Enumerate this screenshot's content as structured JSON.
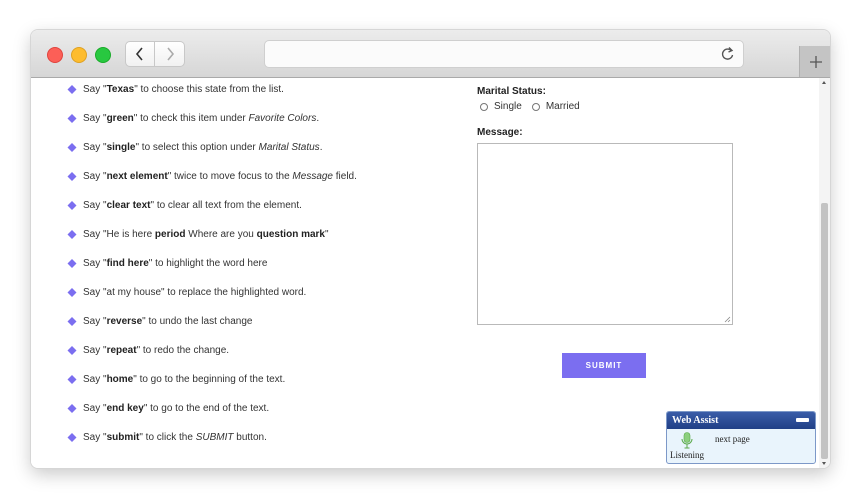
{
  "browser": {
    "url": "",
    "back_icon": "chevron-left-icon",
    "forward_icon": "chevron-right-icon",
    "reload_icon": "reload-icon",
    "new_tab_icon": "plus-icon"
  },
  "instructions": [
    {
      "parts": [
        [
          "n",
          "Say \""
        ],
        [
          "b",
          "Texas"
        ],
        [
          "n",
          "\" to choose this state from the list."
        ]
      ]
    },
    {
      "parts": [
        [
          "n",
          "Say \""
        ],
        [
          "b",
          "green"
        ],
        [
          "n",
          "\" to check this item under "
        ],
        [
          "i",
          "Favorite Colors"
        ],
        [
          "n",
          "."
        ]
      ]
    },
    {
      "parts": [
        [
          "n",
          "Say \""
        ],
        [
          "b",
          "single"
        ],
        [
          "n",
          "\" to select this option under "
        ],
        [
          "i",
          "Marital Status"
        ],
        [
          "n",
          "."
        ]
      ]
    },
    {
      "parts": [
        [
          "n",
          "Say \""
        ],
        [
          "b",
          "next element"
        ],
        [
          "n",
          "\" twice to move focus to the "
        ],
        [
          "i",
          "Message"
        ],
        [
          "n",
          " field."
        ]
      ]
    },
    {
      "parts": [
        [
          "n",
          "Say \""
        ],
        [
          "b",
          "clear text"
        ],
        [
          "n",
          "\" to clear all text from the element."
        ]
      ]
    },
    {
      "parts": [
        [
          "n",
          "Say \"He is here "
        ],
        [
          "b",
          "period"
        ],
        [
          "n",
          " Where are you "
        ],
        [
          "b",
          "question mark"
        ],
        [
          "n",
          "\""
        ]
      ]
    },
    {
      "parts": [
        [
          "n",
          "Say \""
        ],
        [
          "b",
          "find here"
        ],
        [
          "n",
          "\" to highlight the word here"
        ]
      ]
    },
    {
      "parts": [
        [
          "n",
          "Say \"at my house\" to replace the highlighted word."
        ]
      ]
    },
    {
      "parts": [
        [
          "n",
          "Say \""
        ],
        [
          "b",
          "reverse"
        ],
        [
          "n",
          "\" to undo the last change"
        ]
      ]
    },
    {
      "parts": [
        [
          "n",
          "Say \""
        ],
        [
          "b",
          "repeat"
        ],
        [
          "n",
          "\" to redo the change."
        ]
      ]
    },
    {
      "parts": [
        [
          "n",
          "Say \""
        ],
        [
          "b",
          "home"
        ],
        [
          "n",
          "\" to go to the beginning of the text."
        ]
      ]
    },
    {
      "parts": [
        [
          "n",
          "Say \""
        ],
        [
          "b",
          "end key"
        ],
        [
          "n",
          "\" to go to the end of the text."
        ]
      ]
    },
    {
      "parts": [
        [
          "n",
          "Say \""
        ],
        [
          "b",
          "submit"
        ],
        [
          "n",
          "\" to click the "
        ],
        [
          "i",
          "SUBMIT"
        ],
        [
          "n",
          " button."
        ]
      ]
    }
  ],
  "form": {
    "marital_label": "Marital Status:",
    "option_single": "Single",
    "option_married": "Married",
    "message_label": "Message:",
    "message_value": "",
    "submit_label": "SUBMIT"
  },
  "assist": {
    "title": "Web Assist",
    "status": "Listening",
    "heard": "next page"
  },
  "colors": {
    "bullet": "#7b6ef0",
    "submit": "#7b6ef0",
    "assist_header": "#2c4b95"
  }
}
